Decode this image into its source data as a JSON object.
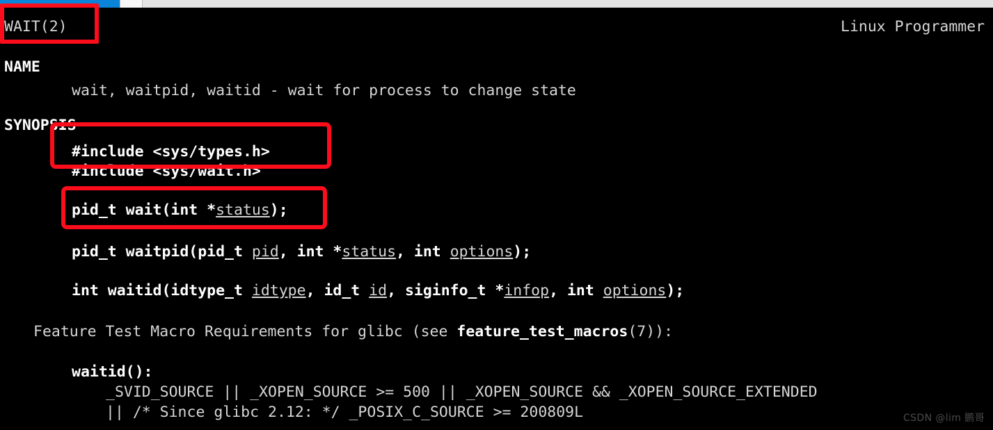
{
  "window": {
    "chrome": {
      "progress_segment_label": "blue-progress-segment",
      "scroll_thumb_label": "scroll-thumb",
      "scroll_track_label": "scroll-track"
    }
  },
  "manpage": {
    "header": {
      "left": "WAIT(2)",
      "right": "Linux Programmer"
    },
    "sections": {
      "name_heading": "NAME",
      "name_body": "wait, waitpid, waitid - wait for process to change state",
      "synopsis_heading": "SYNOPSIS"
    },
    "synopsis": {
      "include_1": "#include <sys/types.h>",
      "include_2": "#include <sys/wait.h>",
      "wait_proto": {
        "pre": "pid_t wait(int *",
        "param": "status",
        "post": ");"
      },
      "waitpid_proto": {
        "p1": "pid_t waitpid(pid_t ",
        "a1": "pid",
        "p2": ", int *",
        "a2": "status",
        "p3": ", int ",
        "a3": "options",
        "p4": ");"
      },
      "waitid_proto": {
        "p1": "int waitid(idtype_t ",
        "a1": "idtype",
        "p2": ", id_t ",
        "a2": "id",
        "p3": ", siginfo_t *",
        "a3": "infop",
        "p4": ", int ",
        "a4": "options",
        "p5": ");"
      }
    },
    "feature_test": {
      "pre": "Feature Test Macro Requirements for glibc (see ",
      "bold": "feature_test_macros",
      "post": "(7)):",
      "func_label": "waitid():",
      "req_line_1": "_SVID_SOURCE || _XOPEN_SOURCE >= 500 || _XOPEN_SOURCE && _XOPEN_SOURCE_EXTENDED",
      "req_line_2": "|| /* Since glibc 2.12: */ _POSIX_C_SOURCE >= 200809L"
    }
  },
  "annotations": {
    "box_color": "#fc0d1b",
    "box_title_target": "WAIT(2)",
    "box_includes_target": "#include lines",
    "box_wait_target": "pid_t wait(int *status);"
  },
  "watermark": {
    "text": "CSDN @lim 鹏哥",
    "color": "#4a4a4a"
  }
}
